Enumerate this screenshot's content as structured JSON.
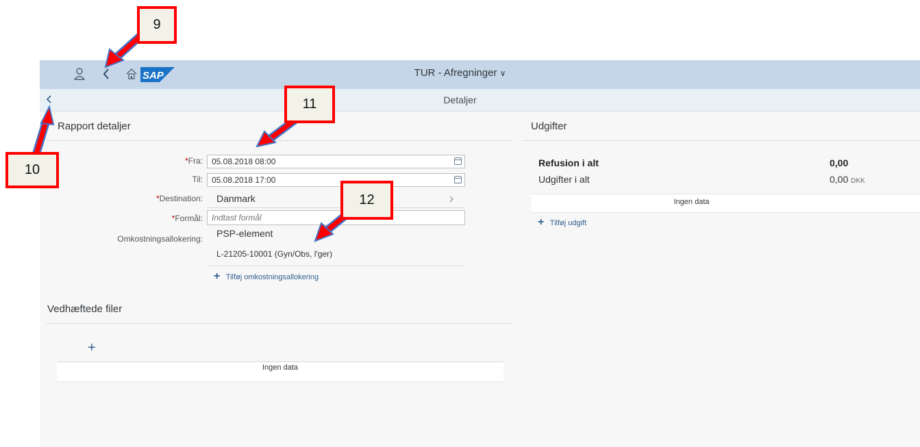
{
  "shell": {
    "app_title": "TUR - Afregninger",
    "title_chevron": "∨",
    "logo_text": "SAP"
  },
  "subheader": {
    "title": "Detaljer"
  },
  "report_section": {
    "title": "Rapport detaljer",
    "fields": {
      "fra": {
        "label": "Fra:",
        "value": "05.08.2018 08:00"
      },
      "til": {
        "label": "Til:",
        "value": "05.08.2018 17:00"
      },
      "destination": {
        "label": "Destination:",
        "value": "Danmark"
      },
      "formal": {
        "label": "Formål:",
        "placeholder": "Indtast formål"
      },
      "allocation": {
        "label": "Omkostningsallokering:",
        "type": "PSP-element",
        "value": "L-21205-10001 (Gyn/Obs, l'ger)"
      }
    },
    "required_mark": "*",
    "add_allocation_label": "Tilføj omkostningsallokering"
  },
  "attachments": {
    "title": "Vedhæftede filer",
    "add_symbol": "+",
    "empty_text": "Ingen data"
  },
  "expenses": {
    "title": "Udgifter",
    "refund_label": "Refusion i alt",
    "refund_value": "0,00",
    "total_label": "Udgifter i alt",
    "total_value": "0,00",
    "currency": "DKK",
    "empty_text": "Ingen data",
    "add_label": "Tilføj udgift"
  },
  "annotations": {
    "c9": "9",
    "c10": "10",
    "c11": "11",
    "c12": "12"
  },
  "colors": {
    "shell": "#c5d6e8",
    "callout_border": "#ff0000",
    "arrow_red": "#ff0000",
    "arrow_blue": "#4472c4"
  }
}
